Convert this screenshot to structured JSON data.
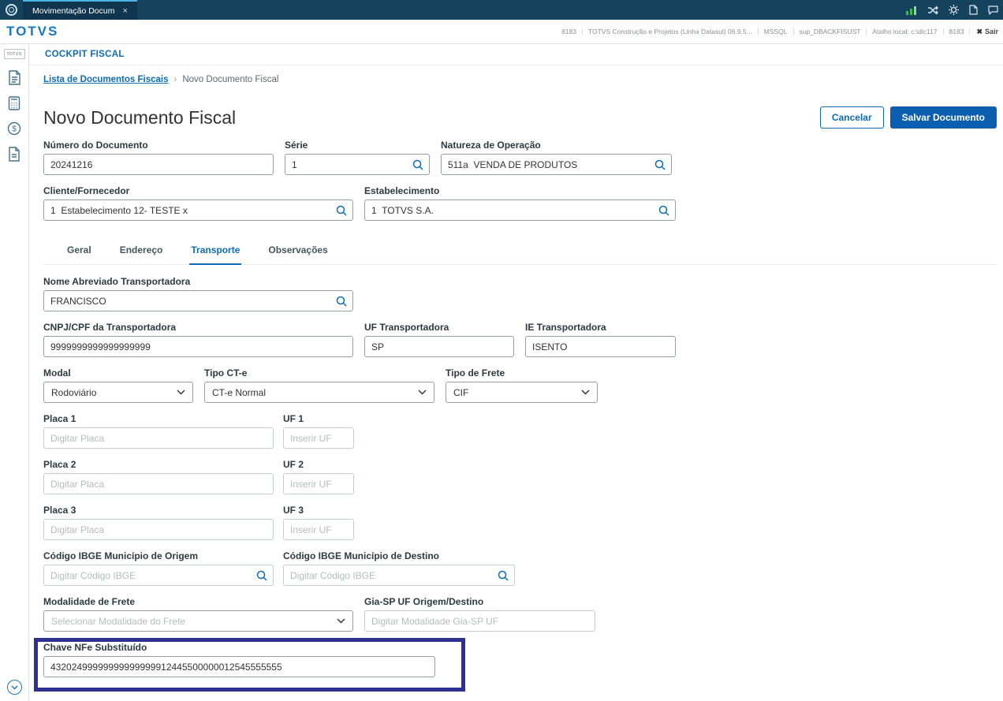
{
  "colors": {
    "primary": "#0c6cb8",
    "save_button": "#0b5eb0",
    "topbar": "#15435e",
    "highlight_ring": "#2e3192",
    "logo_blue": "#1878be",
    "status_green": "#3cc13b"
  },
  "topbar": {
    "tab_label": "Movimentação Docum",
    "close": "×",
    "icons": [
      "connection-status",
      "shuffle",
      "gear",
      "document",
      "chat"
    ]
  },
  "header": {
    "logo": "TOTVS",
    "module": "COCKPIT FISCAL",
    "meta": {
      "env1": "8183",
      "product": "TOTVS Construção e Projetos (Linha Datasul) 06.9.5...",
      "db": "MSSQL",
      "user": "sup_DBACKFISUST",
      "shortcut": "Atalho local: c:\\dlc117",
      "env2": "8183",
      "exit": "Sair",
      "exit_icon": "✖"
    }
  },
  "sidebar": {
    "icons": [
      "totvs-menu",
      "documents",
      "calculator",
      "billing-dollar",
      "document-alt"
    ],
    "bottom_icon": "chevron-down-circle"
  },
  "breadcrumb": {
    "parent": "Lista de Documentos Fiscais",
    "separator": "›",
    "current": "Novo Documento Fiscal"
  },
  "page": {
    "title": "Novo Documento Fiscal",
    "cancel_label": "Cancelar",
    "save_label": "Salvar Documento"
  },
  "fields": {
    "numero": {
      "label": "Número do Documento",
      "value": "20241216"
    },
    "serie": {
      "label": "Série",
      "value": "1"
    },
    "natureza": {
      "label": "Natureza de Operação",
      "value": "511a  VENDA DE PRODUTOS"
    },
    "cliente": {
      "label": "Cliente/Fornecedor",
      "value": "1  Estabelecimento 12- TESTE x"
    },
    "estabelecimento": {
      "label": "Estabelecimento",
      "value": "1  TOTVS S.A."
    }
  },
  "tabs": {
    "geral": "Geral",
    "endereco": "Endereço",
    "transporte": "Transporte",
    "observacoes": "Observações"
  },
  "transport": {
    "nome": {
      "label": "Nome Abreviado Transportadora",
      "value": "FRANCISCO"
    },
    "cnpj": {
      "label": "CNPJ/CPF da Transportadora",
      "value": "9999999999999999999"
    },
    "uf": {
      "label": "UF Transportadora",
      "value": "SP"
    },
    "ie": {
      "label": "IE Transportadora",
      "value": "ISENTO"
    },
    "modal": {
      "label": "Modal",
      "value": "Rodoviário"
    },
    "tipo_cte": {
      "label": "Tipo CT-e",
      "value": "CT-e Normal"
    },
    "tipo_frete": {
      "label": "Tipo de Frete",
      "value": "CIF"
    },
    "placa1": {
      "label": "Placa 1",
      "placeholder": "Digitar Placa"
    },
    "uf1": {
      "label": "UF 1",
      "placeholder": "Inserir UF"
    },
    "placa2": {
      "label": "Placa 2",
      "placeholder": "Digitar Placa"
    },
    "uf2": {
      "label": "UF 2",
      "placeholder": "Inserir UF"
    },
    "placa3": {
      "label": "Placa 3",
      "placeholder": "Digitar Placa"
    },
    "uf3": {
      "label": "UF 3",
      "placeholder": "Inserir UF"
    },
    "ibge_origem": {
      "label": "Código IBGE Município de Origem",
      "placeholder": "Digitar Código IBGE"
    },
    "ibge_destino": {
      "label": "Código IBGE Município de Destino",
      "placeholder": "Digitar Código IBGE"
    },
    "modalidade": {
      "label": "Modalidade de Frete",
      "placeholder": "Selecionar Modalidade do Frete"
    },
    "gia": {
      "label": "Gia-SP UF Origem/Destino",
      "placeholder": "Digitar Modalidade Gia-SP UF"
    },
    "chave": {
      "label": "Chave NFe Substituído",
      "value": "43202499999999999999912445500000012545555555"
    }
  }
}
